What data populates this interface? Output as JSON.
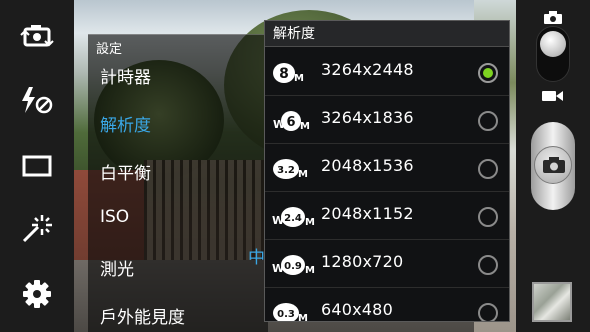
{
  "settings": {
    "title": "設定",
    "items": [
      {
        "label": "計時器"
      },
      {
        "label": "解析度",
        "active": true
      },
      {
        "label": "白平衡"
      },
      {
        "label": "ISO"
      },
      {
        "label": "測光",
        "value_partial": "中"
      },
      {
        "label": "戶外能見度"
      }
    ]
  },
  "resolution": {
    "title": "解析度",
    "options": [
      {
        "badge": "8M",
        "value": "3264x2448",
        "selected": true
      },
      {
        "badge": "W6M",
        "value": "3264x1836",
        "selected": false
      },
      {
        "badge": "3.2M",
        "value": "2048x1536",
        "selected": false
      },
      {
        "badge": "W2.4M",
        "value": "2048x1152",
        "selected": false
      },
      {
        "badge": "W0.9M",
        "value": "1280x720",
        "selected": false
      },
      {
        "badge": "0.3M",
        "value": "640x480",
        "selected": false
      }
    ]
  },
  "left_toolbar": {
    "icons": [
      "switch-camera-icon",
      "flash-off-icon",
      "shooting-mode-icon",
      "effects-icon",
      "settings-gear-icon"
    ]
  },
  "right_bar": {
    "icons": [
      "camera-mode-icon",
      "video-mode-icon",
      "shutter-icon",
      "gallery-thumbnail"
    ]
  },
  "colors": {
    "accent_blue": "#3aa7e6",
    "radio_selected": "#7ed321"
  }
}
